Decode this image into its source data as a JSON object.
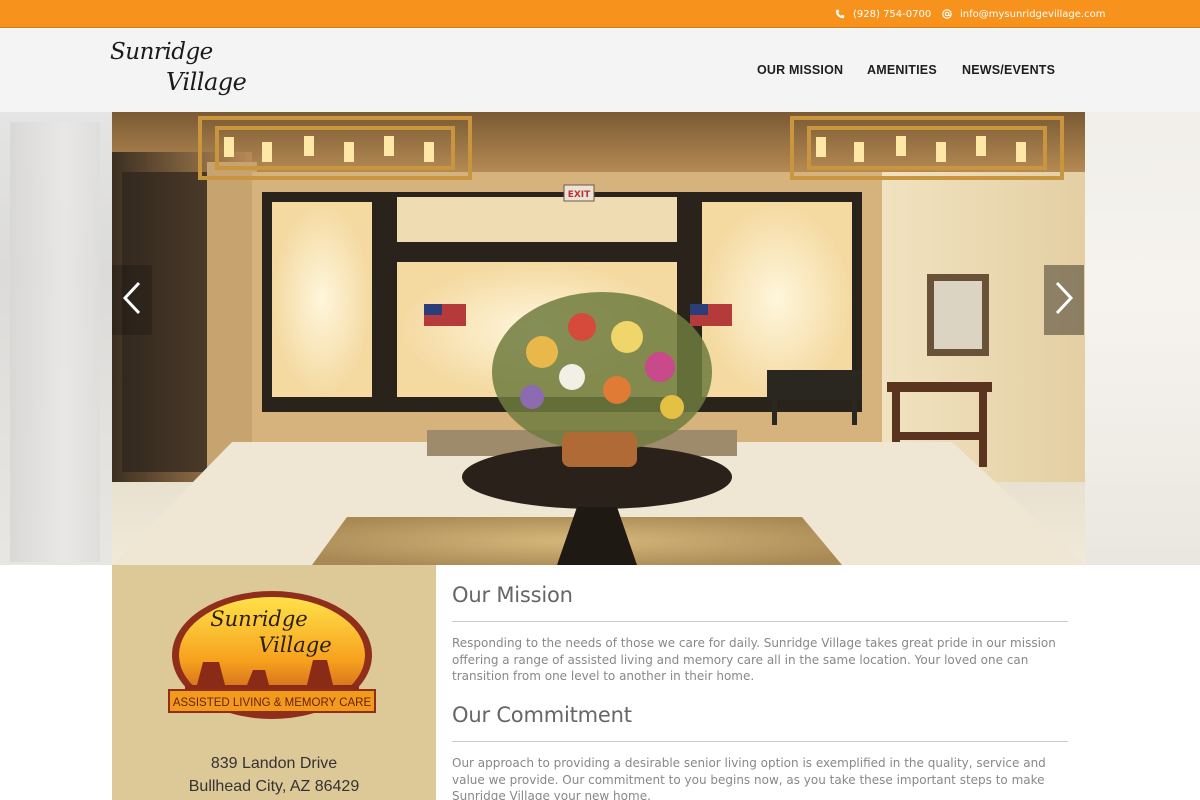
{
  "topbar": {
    "phone": "(928) 754-0700",
    "phone_icon": "phone-icon",
    "email": "info@mysunridgevillage.com",
    "email_icon": "at-icon",
    "color": "#f7931d"
  },
  "header": {
    "logo_line1": "Sunridge",
    "logo_line2": "Village",
    "nav": [
      {
        "label": "OUR MISSION"
      },
      {
        "label": "AMENITIES"
      },
      {
        "label": "NEWS/EVENTS"
      }
    ]
  },
  "hero": {
    "exit_sign": "EXIT",
    "prev_icon": "chevron-left-icon",
    "next_icon": "chevron-right-icon"
  },
  "sidebar": {
    "badge_line1": "Sunridge",
    "badge_line2": "Village",
    "badge_tagline": "ASSISTED LIVING & MEMORY CARE",
    "address_line1": "839 Landon Drive",
    "address_line2": "Bullhead City, AZ 86429",
    "background": "#ddc898"
  },
  "content": {
    "mission_title": "Our Mission",
    "mission_text": "Responding to the needs of those we care for daily. Sunridge Village takes great pride in our mission offering a range of assisted living and memory care all in the same location. Your loved one can transition from one level to another in their home.",
    "commitment_title": "Our Commitment",
    "commitment_text": "Our approach to providing a desirable senior living option is exemplified in the quality, service and value we provide. Our commitment to you begins now, as you take these important steps to make Sunridge Village your new home."
  }
}
